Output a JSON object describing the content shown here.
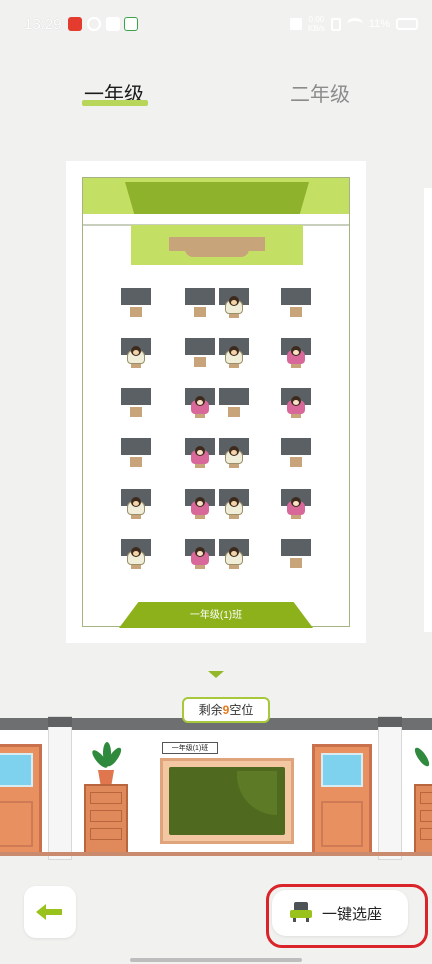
{
  "status_bar": {
    "time": "13:29",
    "network_speed_top": "0.00",
    "network_speed_bottom": "KB/s",
    "battery": "11%"
  },
  "tabs": [
    {
      "label": "一年级",
      "active": true
    },
    {
      "label": "二年级",
      "active": false
    }
  ],
  "classroom": {
    "class_name": "一年级(1)班",
    "seats": [
      [
        "empty",
        "empty",
        "boy",
        "empty"
      ],
      [
        "boy",
        "empty",
        "boy",
        "girl"
      ],
      [
        "empty",
        "girl",
        "empty",
        "girl"
      ],
      [
        "empty",
        "girl",
        "boy",
        "empty"
      ],
      [
        "boy",
        "girl",
        "boy",
        "girl"
      ],
      [
        "boy",
        "girl",
        "boy",
        "empty"
      ]
    ]
  },
  "remaining": {
    "prefix": "剩余",
    "count": "9",
    "suffix": "空位"
  },
  "scene": {
    "board_label": "一年级(1)班"
  },
  "actions": {
    "auto_select_label": "一键选座"
  },
  "colors": {
    "accent_green": "#8db11a",
    "highlight_red": "#d9242a",
    "count_orange": "#e77a19"
  },
  "icons": {
    "back": "arrow-left-icon",
    "auto_select": "seat-icon"
  }
}
